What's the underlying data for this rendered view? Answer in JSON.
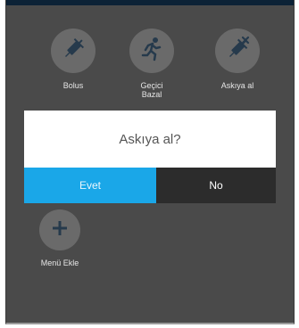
{
  "menu": {
    "items": [
      {
        "label": "Bolus",
        "icon": "syringe-icon"
      },
      {
        "label": "Geçici\nBazal",
        "icon": "running-person-icon"
      },
      {
        "label": "Askıya al",
        "icon": "syringe-cancel-icon"
      }
    ],
    "add": {
      "label": "Menü Ekle",
      "icon": "plus-icon"
    }
  },
  "dialog": {
    "message": "Askıya al?",
    "yes_label": "Evet",
    "no_label": "No"
  },
  "colors": {
    "background": "#4a4a4a",
    "header": "#0c2236",
    "icon_circle": "#6a6a6a",
    "icon_fill": "#263a4c",
    "accent": "#1aa7e8",
    "no_button": "#2c2c2c"
  }
}
